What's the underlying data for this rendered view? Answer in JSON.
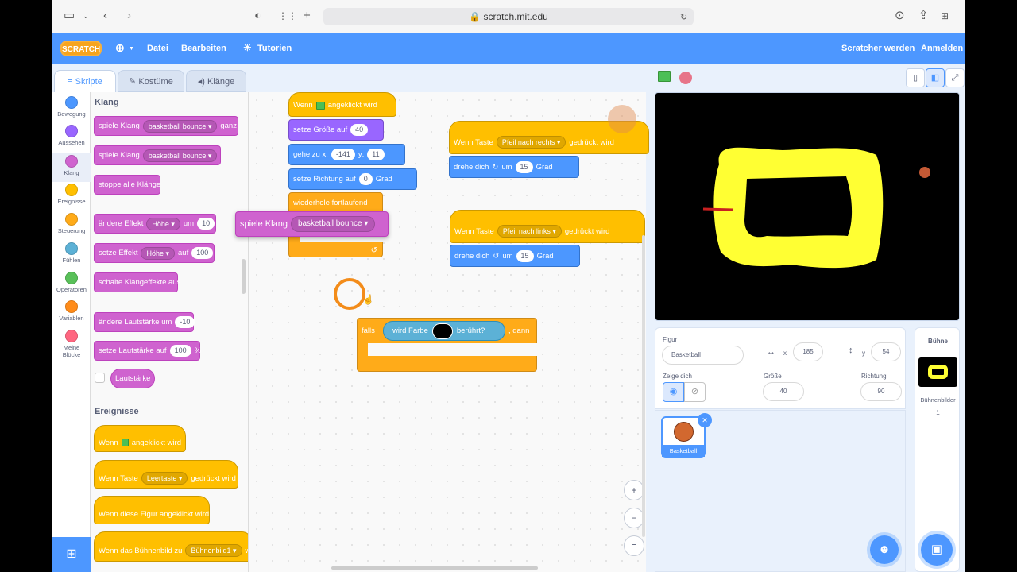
{
  "browser": {
    "url": "scratch.mit.edu"
  },
  "menu": {
    "logo": "SCRATCH",
    "file": "Datei",
    "edit": "Bearbeiten",
    "tutorials": "Tutorien",
    "join": "Scratcher werden",
    "signin": "Anmelden"
  },
  "tabs": {
    "code": "Skripte",
    "costumes": "Kostüme",
    "sounds": "Klänge"
  },
  "categories": [
    {
      "label": "Bewegung",
      "color": "#4c97ff"
    },
    {
      "label": "Aussehen",
      "color": "#9966ff"
    },
    {
      "label": "Klang",
      "color": "#cf63cf"
    },
    {
      "label": "Ereignisse",
      "color": "#ffbf00"
    },
    {
      "label": "Steuerung",
      "color": "#ffab19"
    },
    {
      "label": "Fühlen",
      "color": "#5cb1d6"
    },
    {
      "label": "Operatoren",
      "color": "#59c059"
    },
    {
      "label": "Variablen",
      "color": "#ff8c1a"
    },
    {
      "label": "Meine Blöcke",
      "color": "#ff6680"
    }
  ],
  "palette": {
    "sound_header": "Klang",
    "play_until": {
      "a": "spiele Klang",
      "dd": "basketball bounce",
      "b": "ganz"
    },
    "play": {
      "a": "spiele Klang",
      "dd": "basketball bounce"
    },
    "stop_all": "stoppe alle Klänge",
    "change_effect": {
      "a": "ändere Effekt",
      "dd": "Höhe",
      "b": "um",
      "v": "10"
    },
    "set_effect": {
      "a": "setze Effekt",
      "dd": "Höhe",
      "b": "auf",
      "v": "100"
    },
    "clear_effects": "schalte Klangeffekte aus",
    "change_volume": {
      "a": "ändere Lautstärke um",
      "v": "-10"
    },
    "set_volume": {
      "a": "setze Lautstärke auf",
      "v": "100",
      "b": "%"
    },
    "volume": "Lautstärke",
    "events_header": "Ereignisse",
    "when_flag": {
      "a": "Wenn",
      "b": "angeklickt wird"
    },
    "when_key": {
      "a": "Wenn Taste",
      "dd": "Leertaste",
      "b": "gedrückt wird"
    },
    "when_sprite": "Wenn diese Figur angeklickt wird",
    "when_backdrop": {
      "a": "Wenn das Bühnenbild zu",
      "dd": "Bühnenbild1",
      "b": "w"
    }
  },
  "script1": {
    "hat": {
      "a": "Wenn",
      "b": "angeklickt wird"
    },
    "size": {
      "a": "setze Größe auf",
      "v": "40"
    },
    "goto": {
      "a": "gehe zu x:",
      "x": "-141",
      "b": "y:",
      "y": "11"
    },
    "dir": {
      "a": "setze Richtung auf",
      "v": "0",
      "b": "Grad"
    },
    "forever": "wiederhole fortlaufend"
  },
  "dragged": {
    "a": "spiele Klang",
    "dd": "basketball bounce"
  },
  "script2": {
    "a": "Wenn Taste",
    "dd": "Pfeil nach rechts",
    "b": "gedrückt wird",
    "turn_a": "drehe dich",
    "turn_b": "um",
    "v": "15",
    "turn_c": "Grad"
  },
  "script3": {
    "a": "Wenn Taste",
    "dd": "Pfeil nach links",
    "b": "gedrückt wird",
    "turn_a": "drehe dich",
    "turn_b": "um",
    "v": "15",
    "turn_c": "Grad"
  },
  "ifblock": {
    "a": "falls",
    "sense": "wird Farbe",
    "b": "berührt?",
    "c": ", dann",
    "color": "#000000"
  },
  "zoom": {
    "in": "+",
    "out": "−",
    "reset": "="
  },
  "sprite": {
    "label": "Figur",
    "name": "Basketball",
    "x_label": "x",
    "x": "185",
    "y_label": "y",
    "y": "54",
    "show_label": "Zeige dich",
    "size_label": "Größe",
    "size": "40",
    "dir_label": "Richtung",
    "dir": "90",
    "thumb_name": "Basketball"
  },
  "stage_panel": {
    "title": "Bühne",
    "backdrops_label": "Bühnenbilder",
    "backdrops": "1"
  },
  "colors": {
    "accent": "#4d97ff",
    "track": "#ffff33"
  }
}
